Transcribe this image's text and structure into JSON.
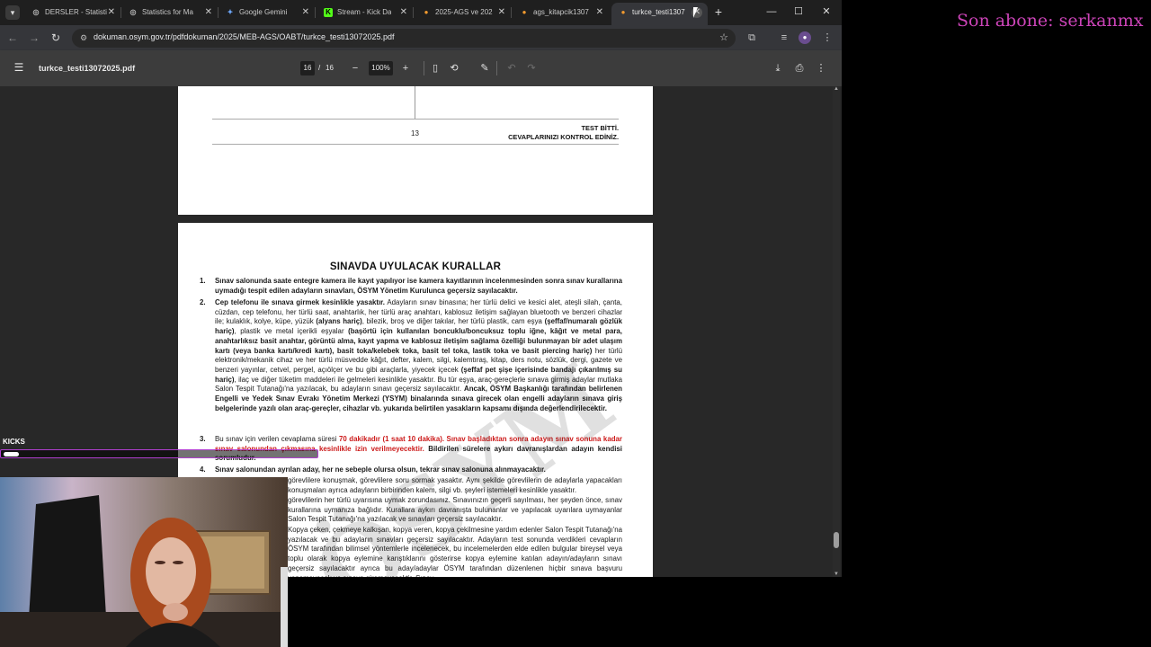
{
  "tabs": [
    {
      "label": "DERSLER - Statisti",
      "favicon": "globe-icon",
      "color": "#bbbbbb",
      "glyph": "◎"
    },
    {
      "label": "Statistics for Ma",
      "favicon": "globe-icon",
      "color": "#bbbbbb",
      "glyph": "◎"
    },
    {
      "label": "Google Gemini",
      "favicon": "gemini-icon",
      "color": "#6ea8fe",
      "glyph": "✦"
    },
    {
      "label": "Stream - Kick Da",
      "favicon": "kick-icon",
      "color": "#53fc18",
      "glyph": "K"
    },
    {
      "label": "2025-AGS ve 202",
      "favicon": "osym-icon",
      "color": "#f29a2e",
      "glyph": "●"
    },
    {
      "label": "ags_kitapcik1307",
      "favicon": "osym-icon",
      "color": "#f29a2e",
      "glyph": "●"
    },
    {
      "label": "turkce_testi1307",
      "favicon": "osym-icon",
      "color": "#f29a2e",
      "glyph": "●"
    }
  ],
  "address": {
    "url": "dokuman.osym.gov.tr/pdfdokuman/2025/MEB-AGS/OABT/turkce_testi13072025.pdf"
  },
  "pdf": {
    "filename": "turkce_testi13072025.pdf",
    "current_page": "16",
    "page_separator": "/",
    "total_pages": "16",
    "zoom": "100%"
  },
  "prev_page": {
    "page_number": "13",
    "end_line1": "TEST BİTTİ.",
    "end_line2": "CEVAPLARINIZI KONTROL EDİNİZ."
  },
  "rules_page": {
    "title": "SINAVDA UYULACAK KURALLAR",
    "rule1_num": "1.",
    "rule1_text": "Sınav salonunda saate entegre kamera ile kayıt yapılıyor ise kamera kayıtlarının incelenmesinden sonra sınav kurallarına uymadığı tespit edilen adayların sınavları, ÖSYM Yönetim Kurulunca geçersiz sayılacaktır.",
    "rule2_num": "2.",
    "rule2_a": "Cep telefonu ile sınava girmek kesinlikle yasaktır.",
    "rule2_b": " Adayların sınav binasına; her türlü delici ve kesici alet, ateşli silah, çanta, cüzdan, cep telefonu, her türlü saat, anahtarlık, her türlü araç anahtarı, kablosuz iletişim sağlayan bluetooth ve benzeri cihazlar ile; kulaklık, kolye, küpe, yüzük ",
    "rule2_c": "(alyans hariç)",
    "rule2_d": ", bilezik, broş ve diğer takılar, her türlü plastik, cam eşya ",
    "rule2_e": "(şeffaf/numaralı gözlük hariç)",
    "rule2_f": ", plastik ve metal içerikli eşyalar ",
    "rule2_g": "(başörtü için kullanılan boncuklu/boncuksuz toplu iğne, kâğıt ve metal para, anahtarlıksız basit anahtar, görüntü alma, kayıt yapma ve kablosuz iletişim sağlama özelliği bulunmayan bir adet ulaşım kartı (veya banka kartı/kredi kartı), basit toka/kelebek toka, basit tel toka, lastik toka ve basit piercing hariç)",
    "rule2_h": " her türlü elektronik/mekanik cihaz ve her türlü müsvedde kâğıt, defter, kalem, silgi, kalemtıraş, kitap, ders notu, sözlük, dergi, gazete ve benzeri yayınlar, cetvel, pergel, açıölçer ve bu gibi araçlarla, yiyecek içecek ",
    "rule2_i": "(şeffaf pet şişe içerisinde bandajı çıkarılmış su hariç)",
    "rule2_j": ", ilaç ve diğer tüketim maddeleri ile gelmeleri kesinlikle yasaktır. Bu tür eşya, araç-gereçlerle sınava girmiş adaylar mutlaka Salon Tespit Tutanağı'na yazılacak, bu adayların sınavı geçersiz sayılacaktır. ",
    "rule2_k": "Ancak, ÖSYM Başkanlığı tarafından belirlenen Engelli ve Yedek Sınav Evrakı Yönetim Merkezi (YSYM) binalarında sınava girecek olan engelli adayların sınava giriş belgelerinde yazılı olan araç-gereçler, cihazlar vb. yukarıda belirtilen yasakların kapsamı dışında değerlendirilecektir.",
    "rule3_num": "3.",
    "rule3_a": "Bu sınav için verilen cevaplama süresi ",
    "rule3_b": "70 dakikadır (1 saat 10 dakika). Sınav başladıktan sonra adayın sınav sonuna kadar sınav salonundan çıkmasına kesinlikle izin verilmeyecektir.",
    "rule3_c": " Bildirilen sürelere aykırı davranışlardan adayın kendisi sorumludur.",
    "rule4_num": "4.",
    "rule4_a": "Sınav salonundan ayrılan aday, her ne sebeple olursa olsun, tekrar sınav salonuna alınmayacaktır.",
    "rule5_text": "görevlilere konuşmak, görevlilere soru sormak yasaktır. Aynı şekilde görevlilerin de adaylarla yapacakları konuşmaları ayrıca adayların birbirinden kalem, silgi vb. şeyleri istemeleri kesinlikle yasaktır.",
    "rule6_text": "görevlilerin her türlü uyarısına uymak zorundasınız. Sınavınızın geçerli sayılması, her şeyden önce, sınav kurallarına uymanıza bağlıdır. Kurallara aykırı davranışta bulunanlar ve yapılacak uyarılara uymayanlar Salon Tespit Tutanağı'na yazılacak ve sınavları geçersiz sayılacaktır.",
    "rule7_text": "Kopya çeken, çekmeye kalkışan, kopya veren, kopya çekilmesine yardım edenler Salon Tespit Tutanağı'na yazılacak ve bu adayların sınavları geçersiz sayılacaktır. Adayların test sonunda verdikleri cevapların ÖSYM tarafından bilimsel yöntemlerle incelenecek, bu incelemelerden elde edilen bulgular bireysel veya toplu olarak kopya eylemine karıştıklarını gösterirse kopya eylemine katılan adayın/adayların sınavı geçersiz sayılacaktır ayrıca bu aday/adaylar ÖSYM tarafından düzenlenen hiçbir sınava başvuru yapamayacak ve sınava giremeyecektir. Sınav"
  },
  "overlay": {
    "last_subscriber": "Son abone: serkanmx",
    "kicks_label": "KICKS",
    "kicks_progress": 0.05
  },
  "colors": {
    "accent_purple": "#cc44b8",
    "kicks_border": "#b03ecf",
    "rule_red": "#cc1a1a"
  }
}
